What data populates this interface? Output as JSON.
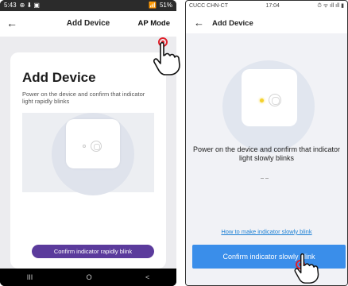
{
  "left_phone": {
    "status_bar": {
      "time": "5:43",
      "battery": "51%"
    },
    "app_bar": {
      "title": "Add Device",
      "ap_mode": "AP Mode"
    },
    "card": {
      "heading": "Add Device",
      "description": "Power on the device and confirm that indicator light rapidly blinks",
      "confirm_button": "Confirm indicator rapidly blink"
    },
    "nav": {
      "recent": "III",
      "home": "O",
      "back": "<"
    }
  },
  "right_phone": {
    "status_bar": {
      "carrier": "CUCC CHN-CT",
      "time": "17:04"
    },
    "app_bar": {
      "title": "Add Device"
    },
    "description": "Power on the device and confirm that indicator light slowly blinks",
    "help_link": "How to make indicator slowly blink",
    "confirm_button": "Confirm indicator slowly blink"
  },
  "colors": {
    "left_button": "#5b3b9c",
    "right_button": "#3a8eea",
    "link": "#1a7fd4",
    "indicator_led": "#f4d12c",
    "tap_marker": "#e0212b"
  }
}
